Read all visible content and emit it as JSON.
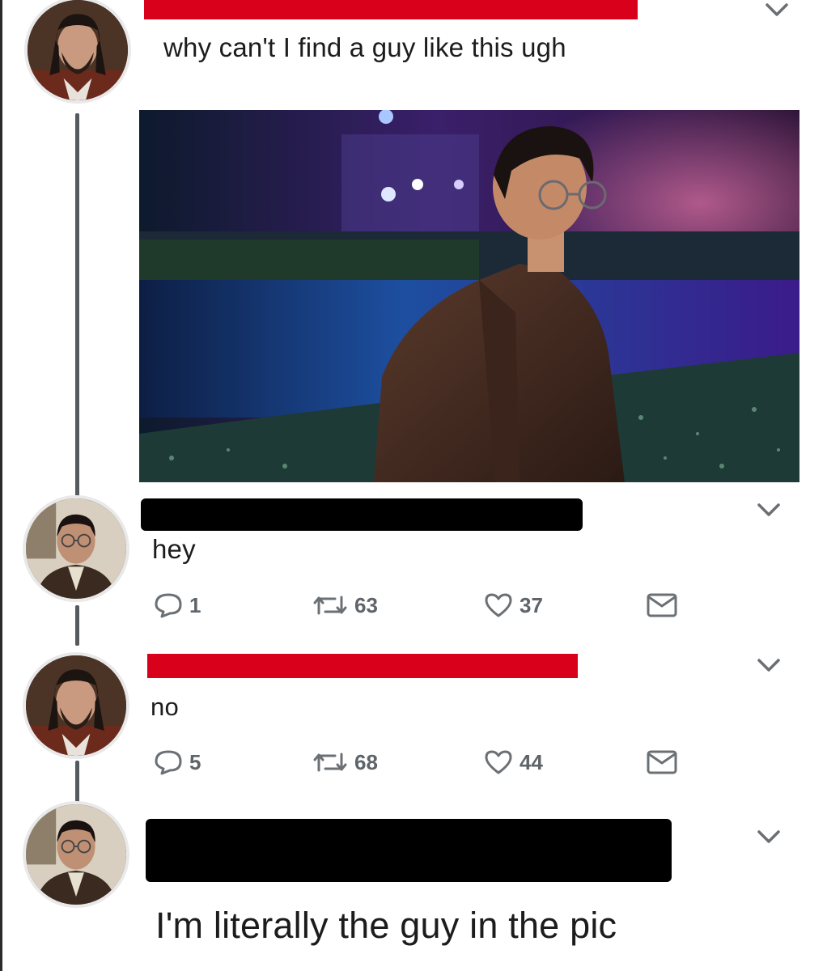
{
  "thread": [
    {
      "text": "why can't I find a guy like this ugh",
      "avatar_icon": "bearded-man-avatar",
      "name_redaction_color": "#d9001b",
      "has_media": true
    },
    {
      "text": "hey",
      "avatar_icon": "glasses-man-avatar",
      "name_redaction_color": "#000000",
      "actions": {
        "replies": "1",
        "retweets": "63",
        "likes": "37"
      }
    },
    {
      "text": "no",
      "avatar_icon": "bearded-man-avatar",
      "name_redaction_color": "#d9001b",
      "actions": {
        "replies": "5",
        "retweets": "68",
        "likes": "44"
      }
    },
    {
      "text": "I'm literally the guy in the pic",
      "avatar_icon": "glasses-man-avatar",
      "name_redaction_color": "#000000"
    }
  ],
  "colors": {
    "accent_red": "#d9001b",
    "action_gray": "#5e6469",
    "thread_line": "#555a5e"
  }
}
